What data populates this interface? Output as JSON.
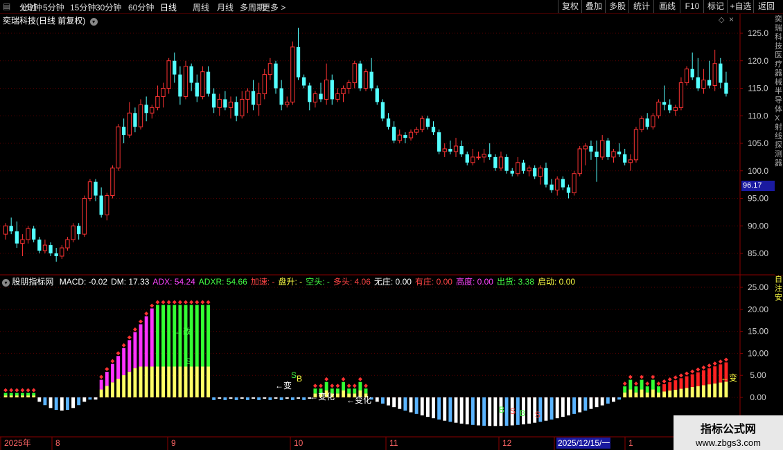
{
  "toolbar": {
    "timeframes": [
      "分时",
      "1分钟",
      "5分钟",
      "15分钟",
      "30分钟",
      "60分钟",
      "日线",
      "周线",
      "月线",
      "多周期",
      "更多 >"
    ],
    "active_timeframe": "日线",
    "buttons": [
      "复权",
      "叠加",
      "多股",
      "统计",
      "画线",
      "F10",
      "标记",
      "+自选",
      "返回"
    ]
  },
  "main_chart": {
    "title": "奕瑞科技(日线 前复权)",
    "current_price_label": "96.17",
    "y_ticks": [
      "125.0",
      "120.0",
      "115.0",
      "110.0",
      "105.0",
      "100.0",
      "95.00",
      "90.00",
      "85.00"
    ],
    "y_tick_values": [
      125,
      120,
      115,
      110,
      105,
      100,
      95,
      90,
      85
    ],
    "colors": {
      "up": "#ff3333",
      "down": "#54ffff",
      "grid": "#5a0000"
    }
  },
  "indicator": {
    "name": "股朋指标网",
    "values": [
      {
        "label": "MACD: -0.02",
        "color": "#ffffff"
      },
      {
        "label": "DM: 17.33",
        "color": "#ffffff"
      },
      {
        "label": "ADX: 54.24",
        "color": "#ff44ff"
      },
      {
        "label": "ADXR: 54.66",
        "color": "#44ff44"
      },
      {
        "label": "加速: -",
        "color": "#ff4444"
      },
      {
        "label": "盘升: -",
        "color": "#ffff44"
      },
      {
        "label": "空头: -",
        "color": "#44ff44"
      },
      {
        "label": "多头: 4.06",
        "color": "#ff4444"
      },
      {
        "label": "无庄: 0.00",
        "color": "#ffffff"
      },
      {
        "label": "有庄: 0.00",
        "color": "#ff4444"
      },
      {
        "label": "高度: 0.00",
        "color": "#ff44ff"
      },
      {
        "label": "出货: 3.38",
        "color": "#44ff44"
      },
      {
        "label": "启动: 0.00",
        "color": "#ffff44"
      }
    ],
    "y_ticks": [
      "25.00",
      "20.00",
      "15.00",
      "10.00",
      "5.00",
      "0.00"
    ],
    "y_tick_values": [
      25,
      20,
      15,
      10,
      5,
      0
    ],
    "annotations": [
      "←改",
      "S",
      "←变",
      "S",
      "B",
      "←变化",
      "←变化",
      "B",
      "S",
      "B",
      "S",
      "←变"
    ]
  },
  "date_axis": {
    "labels": [
      "2025年",
      "8",
      "9",
      "10",
      "11",
      "12",
      "2025/12/15/一",
      "1"
    ]
  },
  "right_strip_text": [
    "奕瑞科技",
    "医疗器械",
    "半导体",
    "X射线",
    "探测器"
  ],
  "watermark": {
    "line1": "指标公式网",
    "line2": "www.zbgs3.com"
  },
  "chart_data": {
    "type": "candlestick",
    "title": "奕瑞科技(日线 前复权)",
    "ylim": [
      82,
      128
    ],
    "x": [
      "2025-07",
      "2025-08",
      "2025-09",
      "2025-10",
      "2025-11",
      "2025-12",
      "2026-01"
    ],
    "candles": [
      [
        88.5,
        90.5,
        87.5,
        90.0
      ],
      [
        90.0,
        91.5,
        88.5,
        89.0
      ],
      [
        89.0,
        90.8,
        86.0,
        86.8
      ],
      [
        86.8,
        88.5,
        84.5,
        87.5
      ],
      [
        87.5,
        90.0,
        86.8,
        89.5
      ],
      [
        89.5,
        90.0,
        87.0,
        87.5
      ],
      [
        87.5,
        88.0,
        85.0,
        85.5
      ],
      [
        85.5,
        87.5,
        85.0,
        86.5
      ],
      [
        86.5,
        87.0,
        84.5,
        85.0
      ],
      [
        85.0,
        86.0,
        83.5,
        84.5
      ],
      [
        84.5,
        86.5,
        84.0,
        86.0
      ],
      [
        86.0,
        88.0,
        85.5,
        87.5
      ],
      [
        87.5,
        90.5,
        87.0,
        90.0
      ],
      [
        90.0,
        90.5,
        87.5,
        88.5
      ],
      [
        88.5,
        95.5,
        88.0,
        95.0
      ],
      [
        95.0,
        98.5,
        94.5,
        98.0
      ],
      [
        98.0,
        98.5,
        94.5,
        95.5
      ],
      [
        95.5,
        97.0,
        91.5,
        92.0
      ],
      [
        92.0,
        96.0,
        91.0,
        95.5
      ],
      [
        95.5,
        101.0,
        95.0,
        100.5
      ],
      [
        100.5,
        108.5,
        100.0,
        108.0
      ],
      [
        108.0,
        109.5,
        105.0,
        106.5
      ],
      [
        106.5,
        112.5,
        106.0,
        110.5
      ],
      [
        110.5,
        111.5,
        107.0,
        108.0
      ],
      [
        108.0,
        113.0,
        107.5,
        112.0
      ],
      [
        112.0,
        113.5,
        109.0,
        110.5
      ],
      [
        110.5,
        112.0,
        109.5,
        111.5
      ],
      [
        111.5,
        115.5,
        111.0,
        113.5
      ],
      [
        113.5,
        116.0,
        111.5,
        115.0
      ],
      [
        115.0,
        120.5,
        114.0,
        120.0
      ],
      [
        120.0,
        121.5,
        116.0,
        117.5
      ],
      [
        117.5,
        119.0,
        112.0,
        113.5
      ],
      [
        113.5,
        120.0,
        113.0,
        119.0
      ],
      [
        119.0,
        119.5,
        114.5,
        116.0
      ],
      [
        116.0,
        117.5,
        112.5,
        113.5
      ],
      [
        113.5,
        119.0,
        113.0,
        118.0
      ],
      [
        118.0,
        119.0,
        113.5,
        114.0
      ],
      [
        114.0,
        115.0,
        110.5,
        111.5
      ],
      [
        111.5,
        114.0,
        110.0,
        113.0
      ],
      [
        113.0,
        114.5,
        111.0,
        111.5
      ],
      [
        111.5,
        113.5,
        109.5,
        112.5
      ],
      [
        112.5,
        113.5,
        109.0,
        110.0
      ],
      [
        110.0,
        114.5,
        109.5,
        113.0
      ],
      [
        113.0,
        115.0,
        110.5,
        114.5
      ],
      [
        114.5,
        116.5,
        111.0,
        112.0
      ],
      [
        112.0,
        116.0,
        110.0,
        114.0
      ],
      [
        114.0,
        118.5,
        113.0,
        117.5
      ],
      [
        117.5,
        120.5,
        116.5,
        119.5
      ],
      [
        119.5,
        120.0,
        114.0,
        115.0
      ],
      [
        115.0,
        116.5,
        111.0,
        112.0
      ],
      [
        112.0,
        113.5,
        111.5,
        112.5
      ],
      [
        112.5,
        123.5,
        112.0,
        122.5
      ],
      [
        122.5,
        126.0,
        116.5,
        117.0
      ],
      [
        117.0,
        117.5,
        115.0,
        115.5
      ],
      [
        115.5,
        116.0,
        111.0,
        112.5
      ],
      [
        112.5,
        114.5,
        111.5,
        114.0
      ],
      [
        114.0,
        116.0,
        112.5,
        113.0
      ],
      [
        113.0,
        119.5,
        112.0,
        116.5
      ],
      [
        116.5,
        117.5,
        112.0,
        113.0
      ],
      [
        113.0,
        115.0,
        112.5,
        114.0
      ],
      [
        114.0,
        115.5,
        112.5,
        115.0
      ],
      [
        115.0,
        116.5,
        114.0,
        116.0
      ],
      [
        116.0,
        120.0,
        115.0,
        119.5
      ],
      [
        119.5,
        120.0,
        114.5,
        115.0
      ],
      [
        115.0,
        118.5,
        114.5,
        118.0
      ],
      [
        118.0,
        120.5,
        114.5,
        115.0
      ],
      [
        115.0,
        115.5,
        112.0,
        112.5
      ],
      [
        112.5,
        113.0,
        109.0,
        109.5
      ],
      [
        109.5,
        110.5,
        107.5,
        108.0
      ],
      [
        108.0,
        109.0,
        105.0,
        105.5
      ],
      [
        105.5,
        107.5,
        105.0,
        106.5
      ],
      [
        106.5,
        107.0,
        105.0,
        106.0
      ],
      [
        106.0,
        107.5,
        105.5,
        107.0
      ],
      [
        107.0,
        108.0,
        106.5,
        107.5
      ],
      [
        107.5,
        110.0,
        107.0,
        109.5
      ],
      [
        109.5,
        110.0,
        107.5,
        108.0
      ],
      [
        108.0,
        109.0,
        106.5,
        107.0
      ],
      [
        107.0,
        107.5,
        103.0,
        103.5
      ],
      [
        103.5,
        105.0,
        102.5,
        104.0
      ],
      [
        104.0,
        105.5,
        103.0,
        103.5
      ],
      [
        103.5,
        106.0,
        102.5,
        104.5
      ],
      [
        104.5,
        105.5,
        102.5,
        103.0
      ],
      [
        103.0,
        103.5,
        101.0,
        101.5
      ],
      [
        101.5,
        104.0,
        101.0,
        102.5
      ],
      [
        102.5,
        103.5,
        102.0,
        102.5
      ],
      [
        102.5,
        104.0,
        101.5,
        103.0
      ],
      [
        103.0,
        105.0,
        102.0,
        102.5
      ],
      [
        102.5,
        103.0,
        100.0,
        100.5
      ],
      [
        100.5,
        103.5,
        100.0,
        102.5
      ],
      [
        102.5,
        103.0,
        99.5,
        100.0
      ],
      [
        100.0,
        100.5,
        99.0,
        99.5
      ],
      [
        99.5,
        102.5,
        99.0,
        101.5
      ],
      [
        101.5,
        102.0,
        99.5,
        100.0
      ],
      [
        100.0,
        101.0,
        99.0,
        100.5
      ],
      [
        100.5,
        101.0,
        98.5,
        99.0
      ],
      [
        99.0,
        101.0,
        97.5,
        100.5
      ],
      [
        100.5,
        101.5,
        97.0,
        97.5
      ],
      [
        97.5,
        98.5,
        96.0,
        96.5
      ],
      [
        96.5,
        99.0,
        95.5,
        98.5
      ],
      [
        98.5,
        99.0,
        96.5,
        97.0
      ],
      [
        97.0,
        97.5,
        95.0,
        96.0
      ],
      [
        96.0,
        100.0,
        95.5,
        99.5
      ],
      [
        99.5,
        104.5,
        99.0,
        104.0
      ],
      [
        104.0,
        105.0,
        101.0,
        104.5
      ],
      [
        104.5,
        105.5,
        102.0,
        103.5
      ],
      [
        103.5,
        105.5,
        98.0,
        102.5
      ],
      [
        102.5,
        106.5,
        102.0,
        105.5
      ],
      [
        105.5,
        106.0,
        102.0,
        102.5
      ],
      [
        102.5,
        104.0,
        101.5,
        103.5
      ],
      [
        103.5,
        105.0,
        102.5,
        103.0
      ],
      [
        103.0,
        104.0,
        101.0,
        101.5
      ],
      [
        101.5,
        103.0,
        100.0,
        102.0
      ],
      [
        102.0,
        108.0,
        101.5,
        107.5
      ],
      [
        107.5,
        110.0,
        107.0,
        109.5
      ],
      [
        109.5,
        110.5,
        107.5,
        108.0
      ],
      [
        108.0,
        110.5,
        107.5,
        110.0
      ],
      [
        110.0,
        113.0,
        109.5,
        112.5
      ],
      [
        112.5,
        115.5,
        111.0,
        112.0
      ],
      [
        112.0,
        113.0,
        110.5,
        111.0
      ],
      [
        111.0,
        112.0,
        110.0,
        111.5
      ],
      [
        111.5,
        117.0,
        111.0,
        116.0
      ],
      [
        116.0,
        119.0,
        115.5,
        118.5
      ],
      [
        118.5,
        121.5,
        116.5,
        117.0
      ],
      [
        117.0,
        120.5,
        114.5,
        115.0
      ],
      [
        115.0,
        118.5,
        114.0,
        116.5
      ],
      [
        116.5,
        120.0,
        115.0,
        115.5
      ],
      [
        115.5,
        122.0,
        114.5,
        119.5
      ],
      [
        119.5,
        120.5,
        115.0,
        116.0
      ],
      [
        116.0,
        118.0,
        113.5,
        114.0
      ]
    ]
  }
}
